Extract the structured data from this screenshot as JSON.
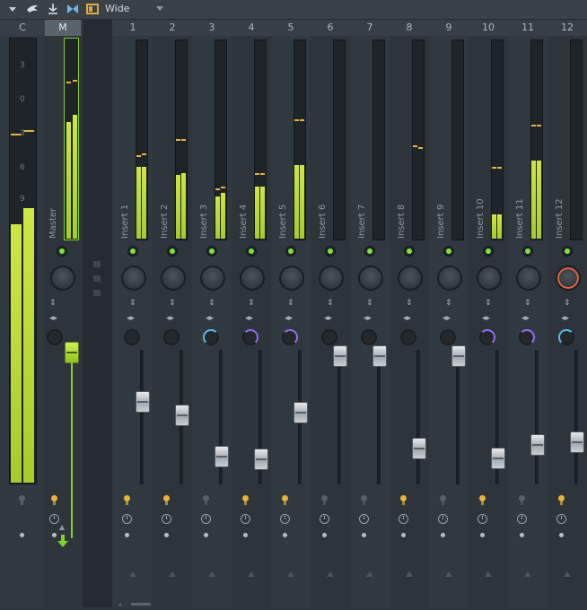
{
  "toolbar": {
    "width_mode": "Wide",
    "icons": [
      "menu-arrow-icon",
      "bird-icon",
      "pin-icon",
      "butterfly-icon",
      "window-icon"
    ]
  },
  "headers": {
    "current": "C",
    "master": "M",
    "inserts": [
      "1",
      "2",
      "3",
      "4",
      "5",
      "6",
      "7",
      "8",
      "9",
      "10",
      "11",
      "12"
    ]
  },
  "master": {
    "label": "Master",
    "scale_marks": [
      "3",
      "0",
      "3",
      "6",
      "9"
    ]
  },
  "tracks": [
    {
      "label": "Insert 1",
      "fader": 0.62,
      "level_l": 0.36,
      "level_r": 0.36,
      "peak_l": 0.42,
      "peak_r": 0.43,
      "fx": "off"
    },
    {
      "label": "Insert 2",
      "fader": 0.52,
      "level_l": 0.32,
      "level_r": 0.33,
      "peak_l": 0.5,
      "peak_r": 0.5,
      "fx": "off"
    },
    {
      "label": "Insert 3",
      "fader": 0.21,
      "level_l": 0.21,
      "level_r": 0.23,
      "peak_l": 0.25,
      "peak_r": 0.26,
      "fx": "cyan"
    },
    {
      "label": "Insert 4",
      "fader": 0.19,
      "level_l": 0.26,
      "level_r": 0.26,
      "peak_l": 0.33,
      "peak_r": 0.33,
      "fx": "purple"
    },
    {
      "label": "Insert 5",
      "fader": 0.54,
      "level_l": 0.37,
      "level_r": 0.37,
      "peak_l": 0.6,
      "peak_r": 0.6,
      "fx": "purple"
    },
    {
      "label": "Insert 6",
      "fader": 0.96,
      "level_l": 0,
      "level_r": 0,
      "peak_l": null,
      "peak_r": null,
      "fx": "off"
    },
    {
      "label": "Insert 7",
      "fader": 0.96,
      "level_l": 0,
      "level_r": 0,
      "peak_l": null,
      "peak_r": null,
      "fx": "off"
    },
    {
      "label": "Insert 8",
      "fader": 0.27,
      "level_l": 0,
      "level_r": 0,
      "peak_l": 0.47,
      "peak_r": 0.46,
      "fx": "off"
    },
    {
      "label": "Insert 9",
      "fader": 0.96,
      "level_l": 0,
      "level_r": 0,
      "peak_l": null,
      "peak_r": null,
      "fx": "off"
    },
    {
      "label": "Insert 10",
      "fader": 0.2,
      "level_l": 0.12,
      "level_r": 0.12,
      "peak_l": 0.36,
      "peak_r": 0.36,
      "fx": "purple"
    },
    {
      "label": "Insert 11",
      "fader": 0.3,
      "level_l": 0.39,
      "level_r": 0.39,
      "peak_l": 0.57,
      "peak_r": 0.57,
      "fx": "purple"
    },
    {
      "label": "Insert 12",
      "fader": 0.32,
      "level_l": 0,
      "level_r": 0,
      "peak_l": null,
      "peak_r": null,
      "fx": "cyan"
    }
  ],
  "colors": {
    "meter": "#bddb3a",
    "peak": "#e0b445",
    "led_on": "#7fe03a",
    "fx_cyan": "#5bb9e6",
    "fx_purple": "#8f6ef0",
    "pan_red": "#e8603f",
    "bulb_on": "#e5b43a"
  }
}
